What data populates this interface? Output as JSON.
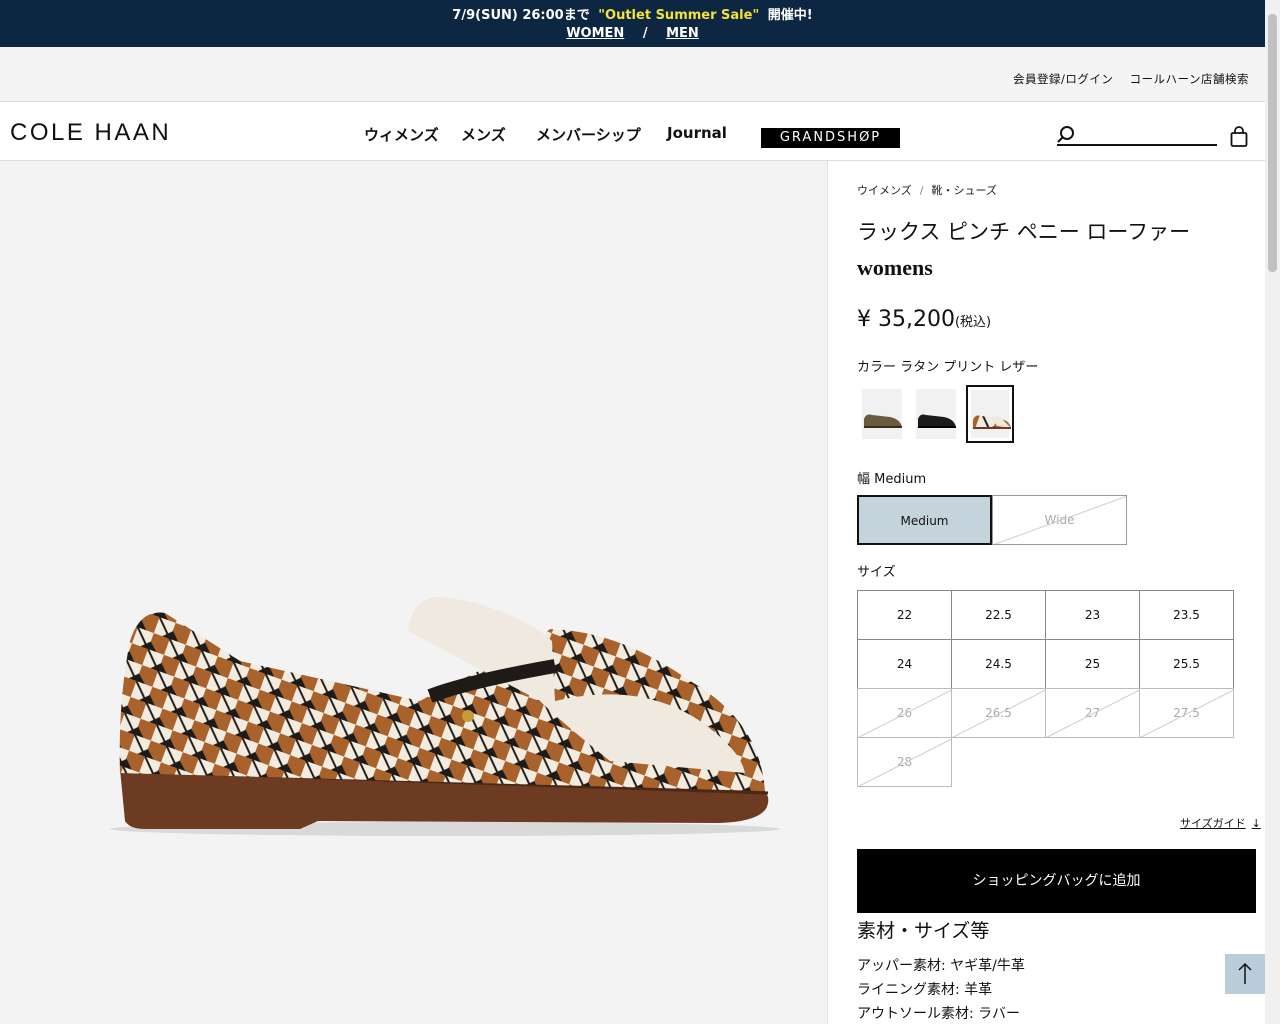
{
  "promo": {
    "date_text": "7/9(SUN) 26:00まで",
    "sale_text": "\"Outlet Summer Sale\"",
    "status_text": "開催中!",
    "women_link": "WOMEN",
    "separator": "/",
    "men_link": "MEN"
  },
  "util": {
    "account_link": "会員登録/ログイン",
    "store_link": "コールハーン店舗検索"
  },
  "header": {
    "logo": "COLE HAAN",
    "nav": [
      "ウィメンズ",
      "メンズ",
      "メンバーシップ",
      "Journal"
    ],
    "grandshop": "GRANDSHØP",
    "search_placeholder": ""
  },
  "breadcrumb": [
    "ウイメンズ",
    "靴・シューズ"
  ],
  "breadcrumb_sep": "/",
  "product": {
    "title": "ラックス ピンチ ペニー ローファー",
    "subtitle": "womens",
    "price": "¥ 35,200",
    "tax_note": "(税込)",
    "color_label": "カラー ラタン プリント レザー",
    "swatches": [
      {
        "name": "olive-leather",
        "color": "#6b5a3e",
        "selected": false
      },
      {
        "name": "black-leather",
        "color": "#1b1b1b",
        "selected": false
      },
      {
        "name": "rattan-print",
        "color": "#9a5a2a",
        "selected": true
      }
    ],
    "width_label": "幅 Medium",
    "widths": [
      {
        "label": "Medium",
        "selected": true,
        "available": true
      },
      {
        "label": "Wide",
        "selected": false,
        "available": false
      }
    ],
    "size_label": "サイズ",
    "sizes": [
      {
        "label": "22",
        "available": true
      },
      {
        "label": "22.5",
        "available": true
      },
      {
        "label": "23",
        "available": true
      },
      {
        "label": "23.5",
        "available": true
      },
      {
        "label": "24",
        "available": true
      },
      {
        "label": "24.5",
        "available": true
      },
      {
        "label": "25",
        "available": true
      },
      {
        "label": "25.5",
        "available": true
      },
      {
        "label": "26",
        "available": false
      },
      {
        "label": "26.5",
        "available": false
      },
      {
        "label": "27",
        "available": false
      },
      {
        "label": "27.5",
        "available": false
      },
      {
        "label": "28",
        "available": false
      }
    ],
    "size_guide": "サイズガイド",
    "add_to_bag": "ショッピングバッグに追加",
    "spec_title": "素材・サイズ等",
    "specs": [
      "アッパー素材: ヤギ革/牛革",
      "ライニング素材: 羊革",
      "アウトソール素材: ラバー"
    ]
  },
  "colors": {
    "banner_bg": "#0d2642",
    "sale_yellow": "#f3e23b",
    "selected_width_bg": "#c5d3dc",
    "to_top_bg": "#b9ccd9"
  }
}
